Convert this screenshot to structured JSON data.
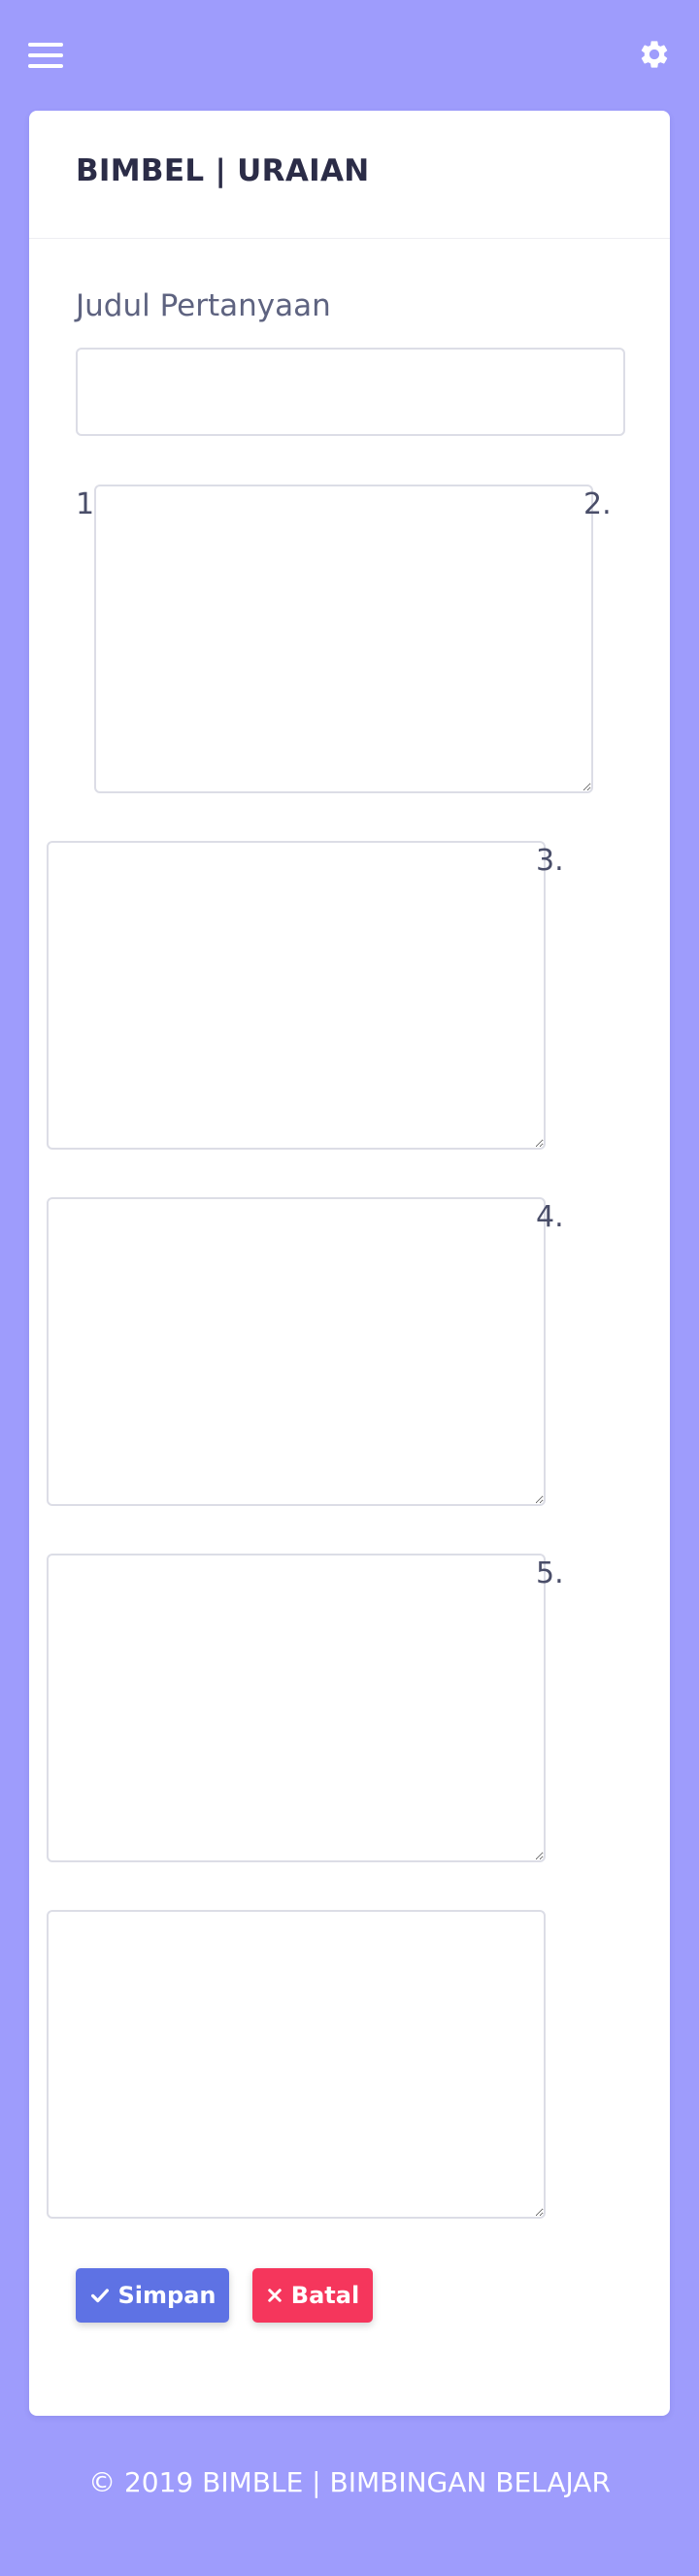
{
  "header": {
    "menu_icon": "menu-icon",
    "settings_icon": "gear-icon"
  },
  "card": {
    "title": "BIMBEL | URAIAN",
    "question_title_label": "Judul Pertanyaan",
    "question_title_value": "",
    "answers": [
      {
        "number": "1",
        "value": ""
      },
      {
        "number": "2.",
        "value": ""
      },
      {
        "number": "3.",
        "value": ""
      },
      {
        "number": "4.",
        "value": ""
      },
      {
        "number": "5.",
        "value": ""
      }
    ],
    "save_label": "Simpan",
    "cancel_label": "Batal"
  },
  "footer": {
    "text": "© 2019 BIMBLE | BIMBINGAN BELAJAR"
  },
  "colors": {
    "background": "#9e9cfc",
    "primary": "#5e72e4",
    "danger": "#f5365c"
  }
}
